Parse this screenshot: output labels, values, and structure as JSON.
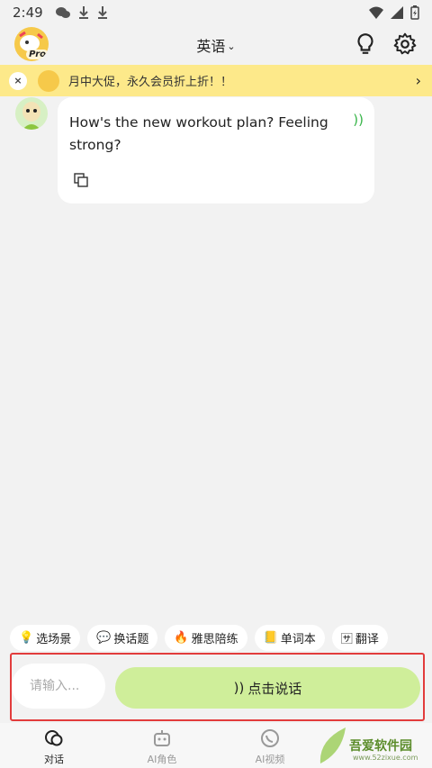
{
  "status_bar": {
    "time": "2:49"
  },
  "header": {
    "language": "英语",
    "logo_badge": "Pro"
  },
  "promo": {
    "close_glyph": "×",
    "text": "月中大促，永久会员折上折！！",
    "arrow_glyph": "›"
  },
  "chat": {
    "message": "How's the new workout plan? Feeling strong?",
    "voice_glyph": "))"
  },
  "chips": [
    {
      "emoji": "💡",
      "label": "选场景"
    },
    {
      "emoji": "💬",
      "label": "换话题"
    },
    {
      "emoji": "🔥",
      "label": "雅思陪练"
    },
    {
      "emoji": "📒",
      "label": "单词本"
    },
    {
      "emoji": "🈂",
      "label": "翻译"
    }
  ],
  "input": {
    "placeholder": "请输入..."
  },
  "speak_button": {
    "label": "点击说话",
    "icon_glyph": "))"
  },
  "tabs": [
    {
      "label": "对话",
      "icon": "chat-bubble-icon",
      "active": true
    },
    {
      "label": "AI角色",
      "icon": "robot-icon",
      "active": false
    },
    {
      "label": "AI视频",
      "icon": "video-call-icon",
      "active": false
    }
  ],
  "watermark": {
    "brand": "吾爱软件园",
    "url": "www.52zixue.com"
  },
  "colors": {
    "promo_bg": "#fde98a",
    "speak_bg": "#cfee9a",
    "accent_green": "#39b54a",
    "highlight_red": "#e23c3c"
  }
}
